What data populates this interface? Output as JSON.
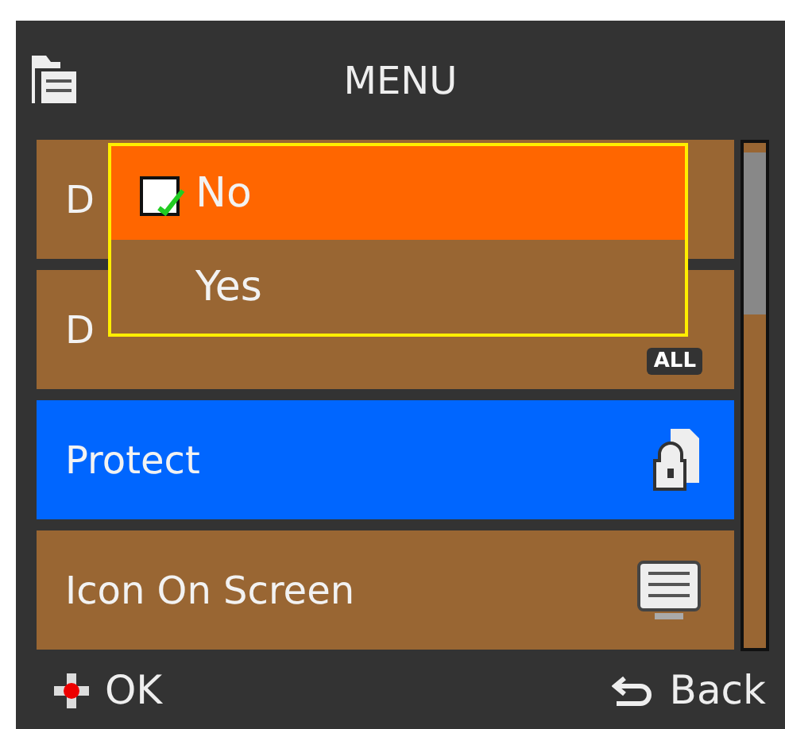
{
  "header": {
    "title": "MENU"
  },
  "menu_items": [
    {
      "label": "D",
      "kind": "plain",
      "selected": false
    },
    {
      "label": "D",
      "kind": "badge",
      "icon_text": "ALL",
      "selected": false
    },
    {
      "label": "Protect",
      "kind": "lock",
      "selected": true
    },
    {
      "label": "Icon On Screen",
      "kind": "grid",
      "selected": false
    }
  ],
  "popup": {
    "options": [
      {
        "label": "No",
        "selected": true,
        "checked": true
      },
      {
        "label": "Yes",
        "selected": false,
        "checked": false
      }
    ]
  },
  "footer": {
    "ok": "OK",
    "back": "Back"
  }
}
